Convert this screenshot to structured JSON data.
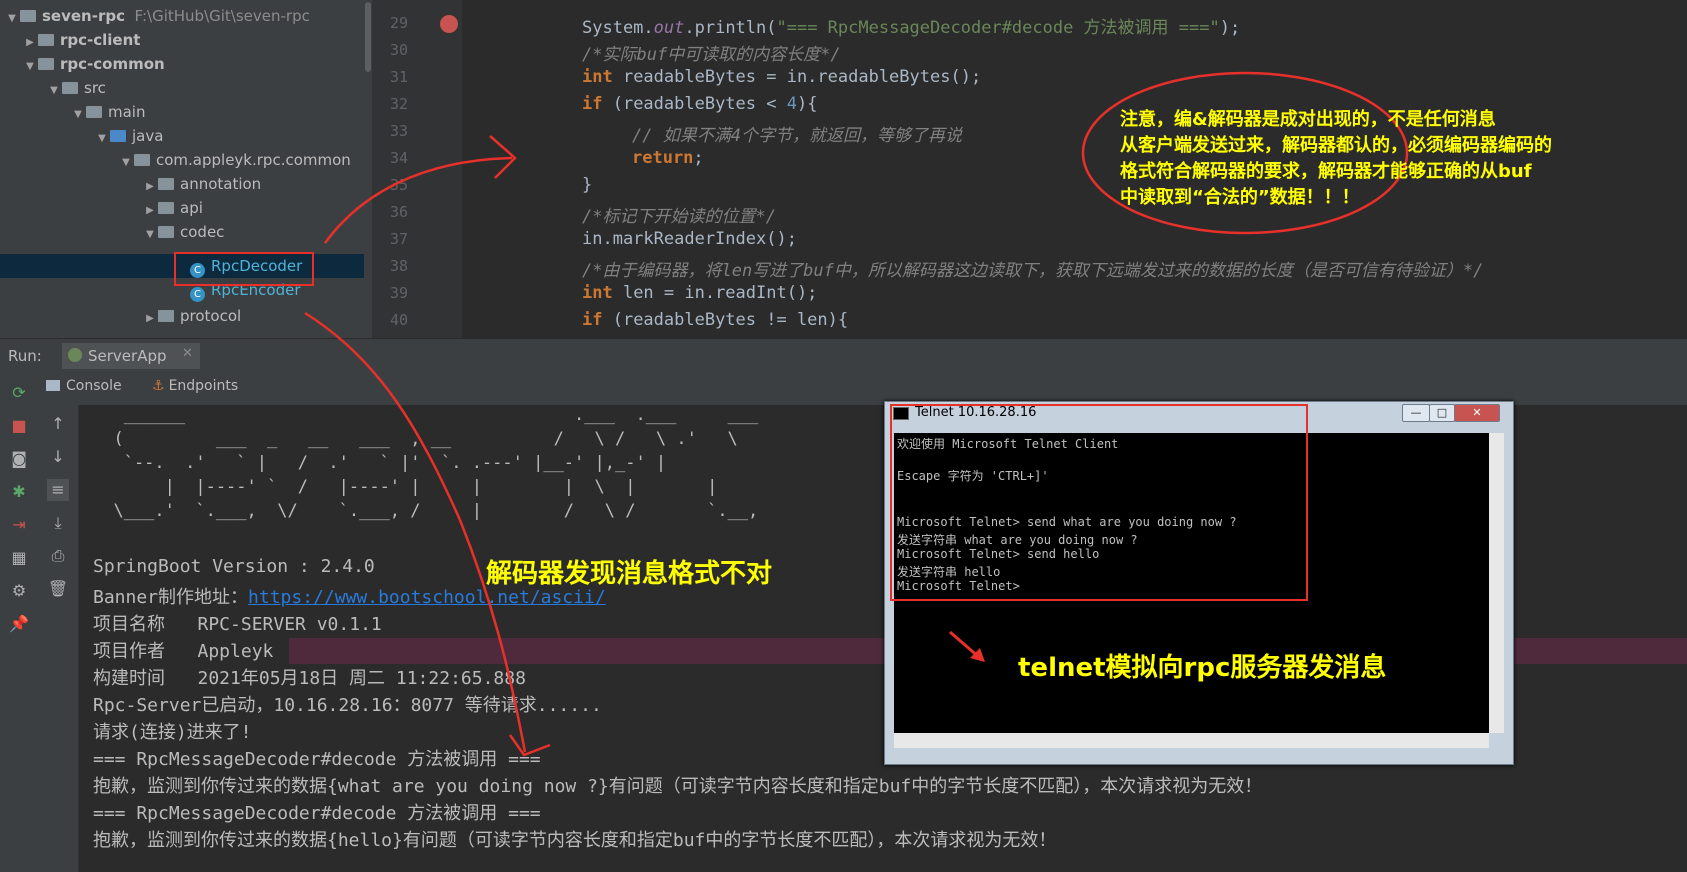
{
  "tree": {
    "project_name": "seven-rpc",
    "project_path": "F:\\GitHub\\Git\\seven-rpc",
    "items": [
      {
        "label": "rpc-client"
      },
      {
        "label": "rpc-common"
      },
      {
        "label": "src"
      },
      {
        "label": "main"
      },
      {
        "label": "java"
      },
      {
        "label": "com.appleyk.rpc.common"
      },
      {
        "label": "annotation"
      },
      {
        "label": "api"
      },
      {
        "label": "codec"
      },
      {
        "label": "RpcDecoder"
      },
      {
        "label": "RpcEncoder"
      },
      {
        "label": "protocol"
      }
    ]
  },
  "editor": {
    "line_numbers": [
      "29",
      "30",
      "31",
      "32",
      "33",
      "34",
      "35",
      "36",
      "37",
      "38",
      "39",
      "40"
    ],
    "lines": [
      {
        "a": "System.",
        "b": "out",
        "c": ".println(",
        "s": "\"=== RpcMessageDecoder#decode 方法被调用 ===\"",
        "d": ");"
      },
      {
        "cmt": "/*实际buf中可读取的内容长度*/"
      },
      {
        "kw": "int",
        "rest": " readableBytes = in.readableBytes();"
      },
      {
        "kw": "if",
        "rest1": " (readableBytes < ",
        "num": "4",
        "rest2": "){"
      },
      {
        "cmt": "// 如果不满4个字节，就返回，等够了再说"
      },
      {
        "kw": "return",
        "rest": ";"
      },
      {
        "rest": "}"
      },
      {
        "cmt": "/*标记下开始读的位置*/"
      },
      {
        "rest": "in.markReaderIndex();"
      },
      {
        "cmt": "/*由于编码器，将len写进了buf中，所以解码器这边读取下，获取下远端发过来的数据的长度（是否可信有待验证）*/"
      },
      {
        "kw": "int",
        "rest": " len = in.readInt();"
      },
      {
        "kw": "if",
        "rest": " (readableBytes != len){"
      }
    ]
  },
  "run": {
    "label": "Run:",
    "config": "ServerApp",
    "tab_console": "Console",
    "tab_endpoints": "Endpoints"
  },
  "console": {
    "banner": [
      "   ______                                      .___  .___     ___",
      "  (         ___  _   __   ___  , __          /   \\ /   \\ .'   \\",
      "   `--.  .'   ` |   /  .'   ` |'  `. .---' |__-' |,_-' |",
      "       |  |----' `  /   |----' |     |        |  \\  |       |",
      "  \\___.'  `.___,  \\/    `.___, /     |        /   \\ /       `.__,"
    ],
    "lines": [
      "SpringBoot Version : 2.4.0",
      "Banner制作地址：",
      "项目名称   RPC-SERVER v0.1.1",
      "项目作者   Appleyk",
      "构建时间   2021年05月18日 周二 11:22:65.888",
      "Rpc-Server已启动，10.16.28.16：8077 等待请求......",
      "请求(连接)进来了!",
      "=== RpcMessageDecoder#decode 方法被调用 ===",
      "抱歉，监测到你传过来的数据{what are you doing now ?}有问题（可读字节内容长度和指定buf中的字节长度不匹配），本次请求视为无效！",
      "=== RpcMessageDecoder#decode 方法被调用 ===",
      "抱歉，监测到你传过来的数据{hello}有问题（可读字节内容长度和指定buf中的字节长度不匹配），本次请求视为无效！"
    ],
    "banner_link": "https://www.bootschool.net/ascii/"
  },
  "telnet": {
    "title": "Telnet 10.16.28.16",
    "lines": [
      "欢迎使用 Microsoft Telnet Client",
      "",
      "Escape 字符为 'CTRL+]'",
      "",
      "",
      "Microsoft Telnet> send what are you doing now ?",
      "发送字符串 what are you doing now ?",
      "Microsoft Telnet> send hello",
      "发送字符串 hello",
      "Microsoft Telnet>"
    ],
    "min_glyph": "—",
    "max_glyph": "□",
    "close_glyph": "✕"
  },
  "annotations": {
    "note1": [
      "注意，编&解码器是成对出现的，不是任何消息",
      "从客户端发送过来，解码器都认的，必须编码器编码的",
      "格式符合解码器的要求，解码器才能够正确的从buf",
      "中读取到“合法的”数据！！！"
    ],
    "note2": "解码器发现消息格式不对",
    "note3": "telnet模拟向rpc服务器发消息"
  },
  "colors": {
    "annotation_red": "#e8302a",
    "annotation_yellow": "#ffff00",
    "selection": "#0d293e"
  }
}
